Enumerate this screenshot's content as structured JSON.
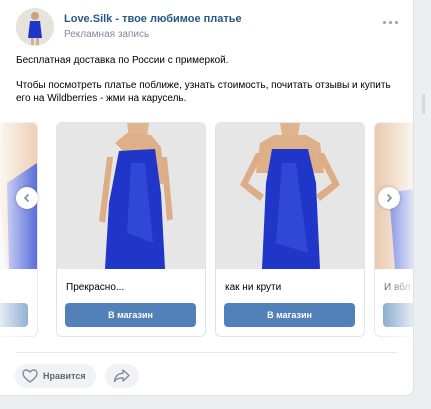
{
  "post": {
    "author": "Love.Silk - твое любимое платье",
    "subtitle": "Рекламная запись",
    "more_icon": "more-horizontal-icon",
    "text": [
      "Бесплатная доставка по России с примеркой.",
      "Чтобы посмотреть платье поближе, узнать стоимость, почитать отзывы и купить его на Wildberries - жми на карусель."
    ]
  },
  "carousel": {
    "cards": [
      {
        "title": "",
        "button": ""
      },
      {
        "title": "Прекрасно...",
        "button": "В магазин"
      },
      {
        "title": "как ни крути",
        "button": "В магазин"
      },
      {
        "title": "И вбл",
        "button": ""
      }
    ],
    "prev_icon": "chevron-left-icon",
    "next_icon": "chevron-right-icon"
  },
  "actions": {
    "like_label": "Нравится",
    "like_icon": "heart-icon",
    "share_icon": "share-icon"
  },
  "colors": {
    "link": "#2a5885",
    "button": "#5181b8",
    "dress": "#1f36c9"
  }
}
